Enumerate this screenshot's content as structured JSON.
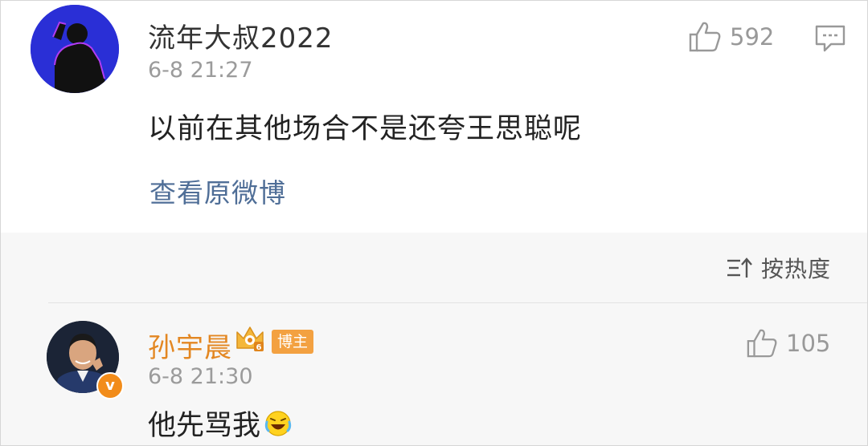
{
  "comment1": {
    "user_name": "流年大叔2022",
    "timestamp": "6-8 21:27",
    "text": "以前在其他场合不是还夸王思聪呢",
    "view_original_link": "查看原微博",
    "like_count": "592"
  },
  "sort": {
    "label": "按热度"
  },
  "comment2": {
    "user_name": "孙宇晨",
    "author_badge": "博主",
    "verified_badge": "v",
    "timestamp": "6-8 21:30",
    "text": "他先骂我",
    "like_count": "105"
  },
  "colors": {
    "link": "#4f6e97",
    "author_name": "#e38722",
    "badge_bg": "#f3a141",
    "muted": "#9b9b9b",
    "background_gray": "#f7f7f7"
  },
  "icons": [
    "thumbs-up-icon",
    "comment-icon",
    "sort-icon",
    "crown-icon",
    "laughing-emoji-icon"
  ]
}
